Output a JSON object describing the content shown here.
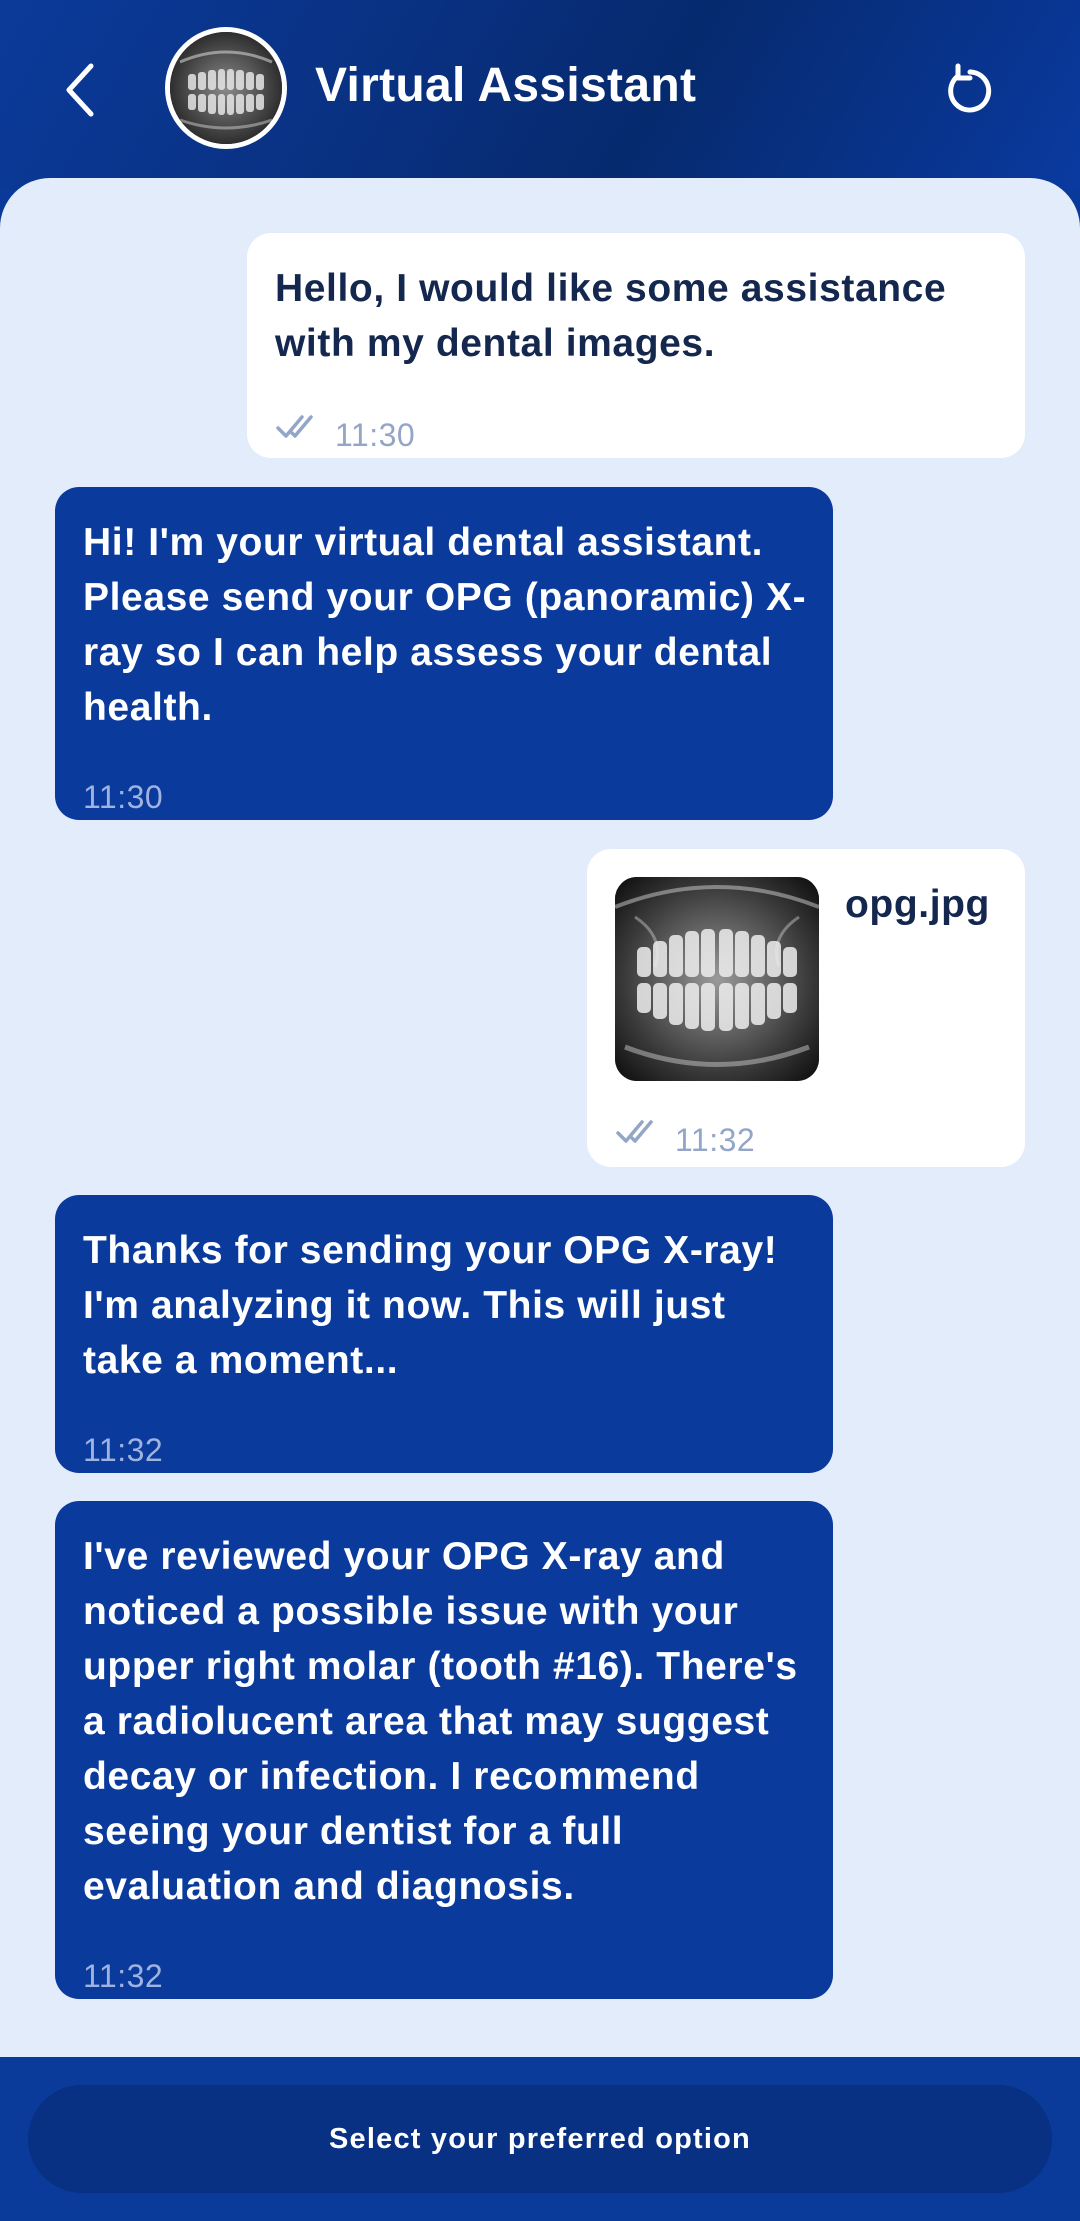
{
  "header": {
    "title": "Virtual Assistant",
    "back_icon": "chevron-left-icon",
    "reset_icon": "refresh-icon"
  },
  "messages": [
    {
      "sender": "user",
      "text": "Hello, I would like some assistance with my dental images.",
      "time": "11:30",
      "status_icon": "double-check-icon"
    },
    {
      "sender": "assistant",
      "text": "Hi! I'm your virtual dental assistant. Please send your OPG (panoramic) X-ray so I can help assess your dental health.",
      "time": "11:30"
    },
    {
      "sender": "user",
      "type": "image",
      "filename": "opg.jpg",
      "time": "11:32",
      "status_icon": "double-check-icon"
    },
    {
      "sender": "assistant",
      "text": "Thanks for sending your OPG X-ray! I'm analyzing it now. This will just take a moment...",
      "time": "11:32"
    },
    {
      "sender": "assistant",
      "text": "I've reviewed your OPG X-ray and noticed a possible issue with your upper right molar (tooth #16). There's a radiolucent area that may suggest decay or infection. I recommend seeing your dentist for a full evaluation and diagnosis.",
      "time": "11:32"
    }
  ],
  "footer": {
    "option_label": "Select your preferred option"
  },
  "colors": {
    "primary": "#0a3a9c",
    "background": "#e3ecfb",
    "user_bubble": "#ffffff",
    "user_text": "#14274e",
    "muted": "#93a6c8"
  }
}
